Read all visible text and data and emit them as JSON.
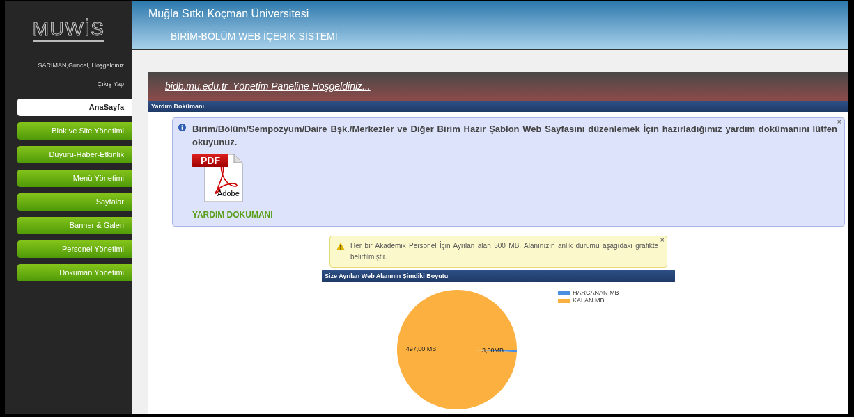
{
  "sidebar": {
    "logo": "MUWİS",
    "user": "SARIMAN,Guncel, Hoşgeldiniz",
    "logout": "Çıkış Yap",
    "items": [
      {
        "label": "AnaSayfa",
        "selected": true
      },
      {
        "label": "Blok ve Site Yönetimi",
        "selected": false
      },
      {
        "label": "Duyuru-Haber-Etkinlik",
        "selected": false
      },
      {
        "label": "Menü Yönetimi",
        "selected": false
      },
      {
        "label": "Sayfalar",
        "selected": false
      },
      {
        "label": "Banner & Galeri",
        "selected": false
      },
      {
        "label": "Personel Yönetimi",
        "selected": false
      },
      {
        "label": "Doküman Yönetimi",
        "selected": false
      }
    ]
  },
  "header": {
    "university": "Muğla Sıtkı Koçman Üniversitesi",
    "system": "BİRİM-BÖLÜM WEB İÇERİK SİSTEMİ"
  },
  "welcome_banner": "bidb.mu.edu.tr  Yönetim Paneline Hoşgeldiniz...",
  "help_section": {
    "title": "Yardım Dokümanı",
    "info": {
      "text": "Birim/Bölüm/Sempozyum/Daire Bşk./Merkezler ve Diğer Birim Hazır Şablon Web Sayfasını düzenlemek İçin hazırladığımız yardım dokümanını lütfen okuyunuz.",
      "close": "×",
      "pdf_badge": "PDF",
      "pdf_brand": "Adobe",
      "link": "YARDIM DOKUMANI"
    }
  },
  "quota_warning": {
    "text": "Her bir Akademik Personel İçin Ayrılan alan 500 MB. Alanınızın anlık durumu aşağıdaki grafikte belirtilmiştir.",
    "close": "×"
  },
  "usage_section": {
    "title": "Size Ayrılan Web Alanının Şimdiki Boyutu",
    "chart_data": {
      "type": "pie",
      "categories": [
        "HARCANAN MB",
        "KALAN MB"
      ],
      "values": [
        3,
        497
      ],
      "colors": [
        "#4a8fe0",
        "#fbb040"
      ],
      "value_labels": [
        "3,00MB",
        "497,00 MB"
      ],
      "legend": "right"
    }
  }
}
